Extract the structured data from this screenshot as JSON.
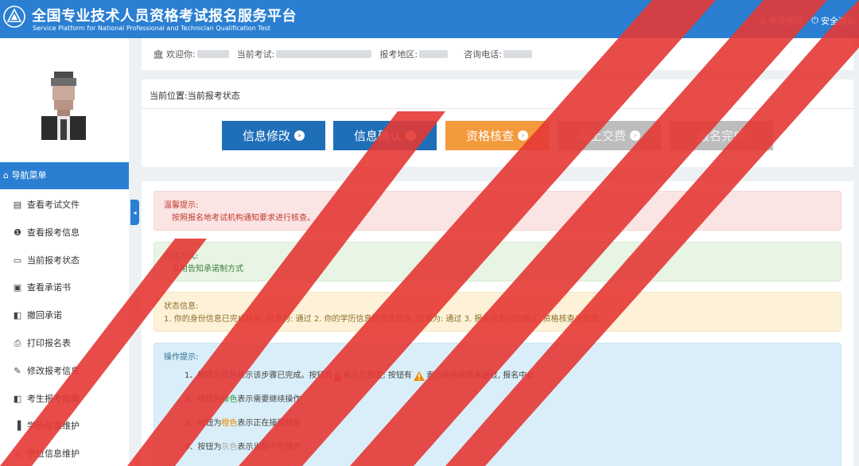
{
  "header": {
    "title_cn": "全国专业技术人员资格考试报名服务平台",
    "title_en": "Service Platform for National Professional and Technician Qualification Test",
    "change_password": "修改密码",
    "logout": "安全退出"
  },
  "info_bar": {
    "welcome": "欢迎你:",
    "current_exam": "当前考试:",
    "region": "报考地区:",
    "phone": "咨询电话:"
  },
  "sidebar": {
    "nav_header": "导航菜单",
    "items": [
      {
        "label": "查看考试文件",
        "icon": "file-icon"
      },
      {
        "label": "查看报考信息",
        "icon": "info-icon"
      },
      {
        "label": "当前报考状态",
        "icon": "monitor-icon"
      },
      {
        "label": "查看承诺书",
        "icon": "card-icon"
      },
      {
        "label": "撤回承诺",
        "icon": "book-icon"
      },
      {
        "label": "打印报名表",
        "icon": "print-icon"
      },
      {
        "label": "修改报考信息",
        "icon": "edit-icon"
      },
      {
        "label": "考生报考指南",
        "icon": "book-icon"
      },
      {
        "label": "学历信息维护",
        "icon": "document-icon"
      },
      {
        "label": "学位信息维护",
        "icon": "graduation-cap-icon"
      }
    ]
  },
  "status": {
    "breadcrumb": "当前位置:当前报考状态",
    "steps": [
      {
        "label": "信息修改",
        "color": "#1e6fb8",
        "arrow": true
      },
      {
        "label": "信息确认",
        "color": "#1e6fb8",
        "arrow": true
      },
      {
        "label": "资格核查",
        "color": "#f39a3c",
        "arrow": true
      },
      {
        "label": "网上交费",
        "color": "#bdbdbd",
        "arrow": true
      },
      {
        "label": "报名完成",
        "color": "#bdbdbd",
        "arrow": false
      }
    ]
  },
  "alerts": {
    "warm_tip_title": "温馨提示:",
    "warm_tip_body": "按照报名地考试机构通知要求进行核查。",
    "method_title": "办理方式:",
    "method_body": "采用告知承诺制方式",
    "status_title": "状态信息:",
    "status_body": "1. 你的身份信息已完成核查, 结果为: 通过 2. 你的学历信息已完成核查, 结果为: 通过 3. 报名信息已经确认, 资格核查未完成。",
    "ops_title": "操作提示:",
    "tip1_a": "1、按钮为",
    "tip1_blue": "蓝色",
    "tip1_b": "表示该步骤已完成。按钮有",
    "tip1_c": "表示已锁定; 按钮有",
    "tip1_d": "表示资格核查未通过, 报名中止",
    "tip2_a": "2、按钮为",
    "tip2_green": "绿色",
    "tip2_b": "表示需要继续操作",
    "tip3_a": "3、按钮为",
    "tip3_orange": "橙色",
    "tip3_b": "表示正在接受核查",
    "tip4_a": "4、按钮为",
    "tip4_gray": "灰色",
    "tip4_b": "表示当前不可操作"
  },
  "colors": {
    "primary": "#2a7fd2",
    "step_blue": "#1e6fb8",
    "step_orange": "#f39a3c",
    "step_gray": "#bdbdbd",
    "watermark_red": "#e53935"
  }
}
